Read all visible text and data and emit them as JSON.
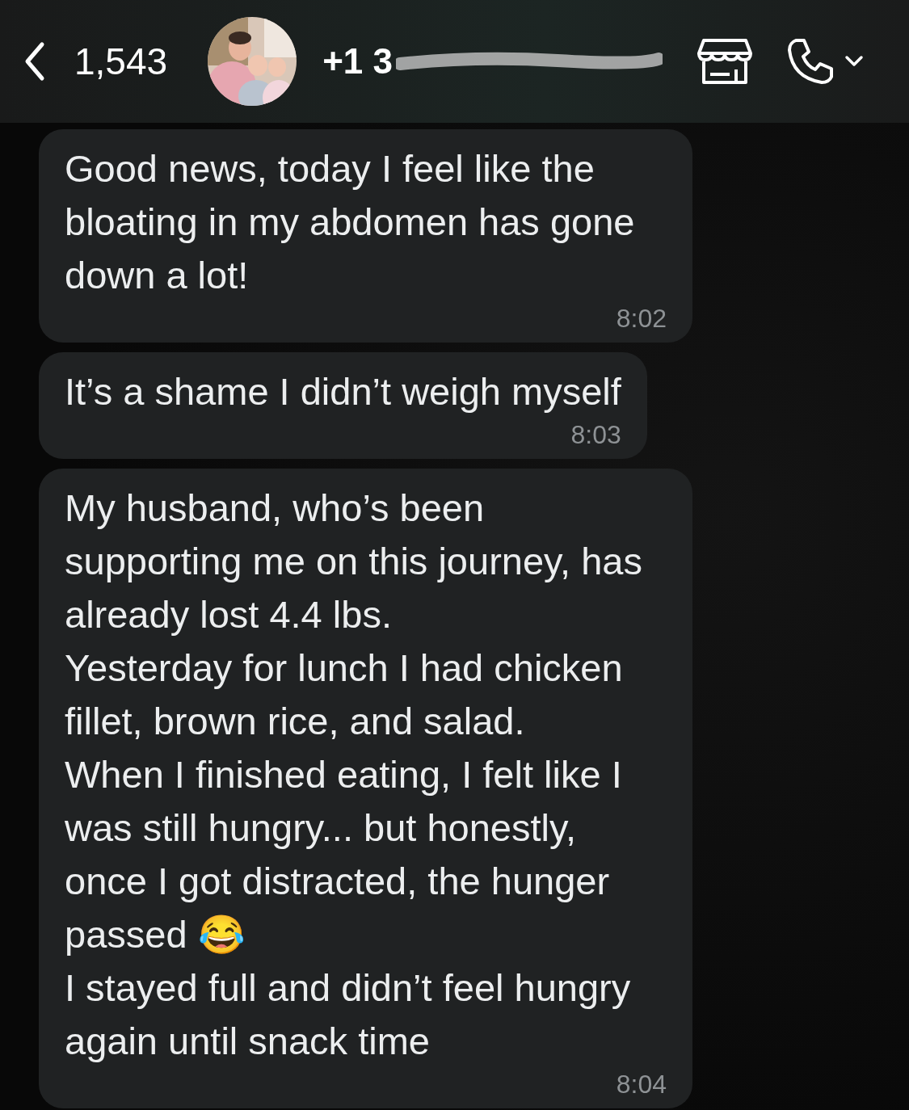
{
  "header": {
    "unread_count": "1,543",
    "contact_name": "+1 3"
  },
  "messages": [
    {
      "text": "Good news, today I feel like the bloating in my abdomen has gone down a lot!",
      "time": "8:02"
    },
    {
      "text": "It’s a shame I didn’t weigh myself",
      "time": "8:03"
    },
    {
      "text": "My husband, who’s been supporting me on this journey, has already lost 4.4 lbs.\nYesterday for lunch I had chicken fillet, brown rice, and salad.\nWhen I finished eating, I felt like I was still hungry... but honestly, once I got distracted, the hunger passed 😂\nI stayed full and didn’t feel hungry again until snack time",
      "time": "8:04"
    }
  ]
}
